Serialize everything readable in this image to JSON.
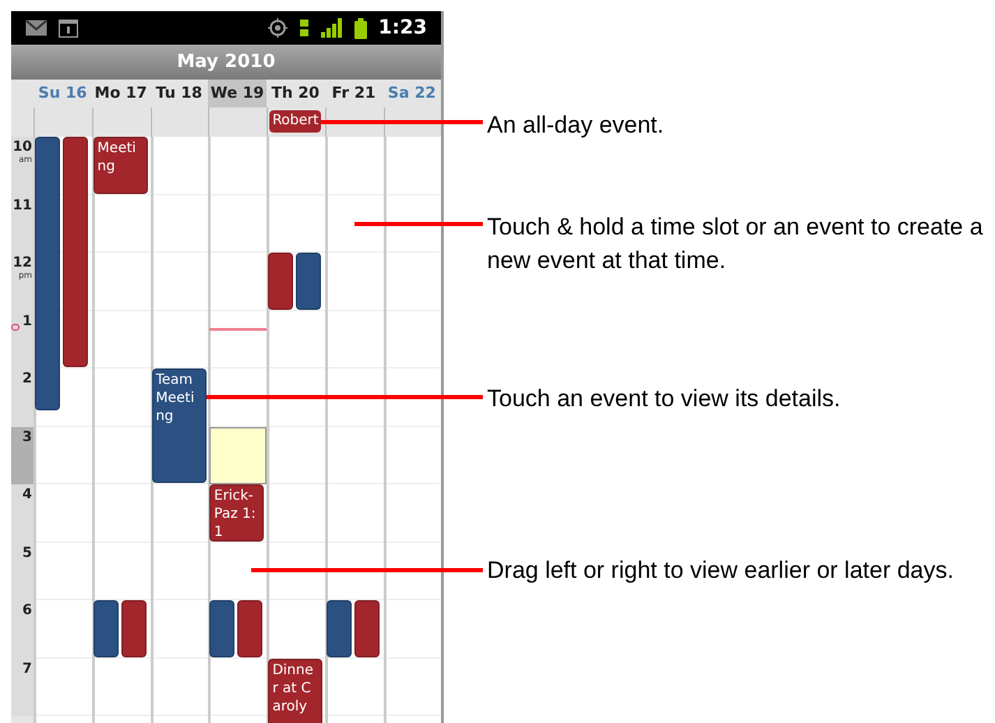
{
  "status_bar": {
    "time": "1:23"
  },
  "title": "May 2010",
  "days": [
    {
      "label": "Su 16",
      "weekend": true,
      "today": false,
      "events": [
        {
          "color": "#2a5182"
        },
        {
          "color": "#a3262c"
        }
      ]
    },
    {
      "label": "Mo 17",
      "weekend": false,
      "today": false,
      "events": [
        {
          "title": "Meeting",
          "color": "#a3262c"
        },
        {
          "color": "#2a5182"
        },
        {
          "color": "#a3262c"
        }
      ]
    },
    {
      "label": "Tu 18",
      "weekend": false,
      "today": false,
      "events": [
        {
          "title": "Team Meeting",
          "color": "#2a5182"
        }
      ]
    },
    {
      "label": "We 19",
      "weekend": false,
      "today": true,
      "selected_slot": true,
      "now_line": true,
      "events": [
        {
          "title": "Erick-Paz 1:1",
          "color": "#a3262c"
        },
        {
          "color": "#2a5182"
        },
        {
          "color": "#a3262c"
        }
      ]
    },
    {
      "label": "Th 20",
      "weekend": false,
      "today": false,
      "all_day": [
        {
          "title": "Robert",
          "color": "#a3262c"
        }
      ],
      "events": [
        {
          "color": "#a3262c"
        },
        {
          "color": "#2a5182"
        },
        {
          "title": "Dinner at Caroly",
          "color": "#a3262c"
        }
      ]
    },
    {
      "label": "Fr 21",
      "weekend": false,
      "today": false,
      "events": [
        {
          "color": "#2a5182"
        },
        {
          "color": "#a3262c"
        }
      ]
    },
    {
      "label": "Sa 22",
      "weekend": true,
      "today": false
    }
  ],
  "hours": [
    {
      "label": "10",
      "suffix": "am",
      "selected": false,
      "now_marker": false
    },
    {
      "label": "11",
      "selected": false,
      "now_marker": false
    },
    {
      "label": "12",
      "suffix": "pm",
      "selected": false,
      "now_marker": false
    },
    {
      "label": "1",
      "selected": false,
      "now_marker": true
    },
    {
      "label": "2",
      "selected": false,
      "now_marker": false
    },
    {
      "label": "3",
      "selected": true,
      "now_marker": false
    },
    {
      "label": "4",
      "selected": false,
      "now_marker": false
    },
    {
      "label": "5",
      "selected": false,
      "now_marker": false
    },
    {
      "label": "6",
      "selected": false,
      "now_marker": false
    },
    {
      "label": "7",
      "selected": false,
      "now_marker": false
    }
  ],
  "annotations": [
    "An all-day event.",
    "Touch & hold a time slot or an event to create a new event at that time.",
    "Touch an event to view its details.",
    "Drag left or right to view earlier or later days."
  ]
}
